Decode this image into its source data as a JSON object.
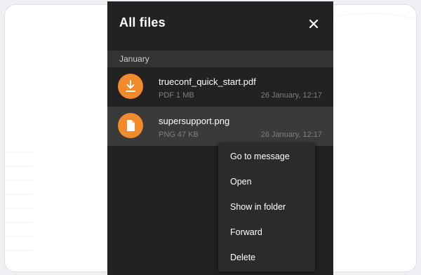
{
  "panel": {
    "title": "All files",
    "close_icon": "close-icon"
  },
  "section": {
    "label": "January"
  },
  "files": [
    {
      "name": "trueconf_quick_start.pdf",
      "meta": "PDF 1 MB",
      "date": "26 January, 12:17",
      "icon": "download-icon"
    },
    {
      "name": "supersupport.png",
      "meta": "PNG 47 KB",
      "date": "26 January, 12:17",
      "icon": "file-icon"
    }
  ],
  "context_menu": {
    "items": [
      "Go to message",
      "Open",
      "Show in folder",
      "Forward",
      "Delete"
    ]
  },
  "colors": {
    "accent": "#f28a2c",
    "panel_bg": "#222222",
    "selected_row": "#3a3a3a",
    "menu_bg": "#2b2b2b"
  }
}
